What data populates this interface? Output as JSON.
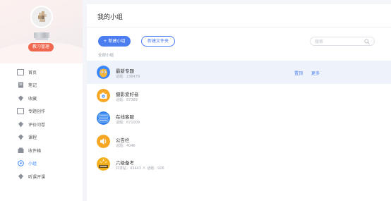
{
  "sidebar": {
    "manage_label": "教习管理",
    "items": [
      {
        "label": "首页",
        "icon": "home-icon"
      },
      {
        "label": "笔记",
        "icon": "note-icon"
      },
      {
        "label": "收藏",
        "icon": "bookmark-icon"
      },
      {
        "label": "专题创作",
        "icon": "topic-icon"
      },
      {
        "label": "评价问卷",
        "icon": "survey-icon"
      },
      {
        "label": "课程",
        "icon": "course-icon"
      },
      {
        "label": "收件箱",
        "icon": "inbox-icon"
      },
      {
        "label": "小组",
        "icon": "group-icon",
        "active": true
      },
      {
        "label": "听课评课",
        "icon": "lecture-icon"
      }
    ]
  },
  "main": {
    "title": "我的小组",
    "new_group_label": "+ 新建小组",
    "new_folder_label": "新建文件夹",
    "search_placeholder": "搜索",
    "section_label": "全部小组",
    "groups": [
      {
        "name": "最新专题",
        "meta": "话题：23647​9",
        "icon": "owl-icon",
        "color": "#3a86ff",
        "actions": [
          "置顶",
          "更多"
        ]
      },
      {
        "name": "摄影爱好者",
        "meta": "话题：87389",
        "icon": "camera-icon",
        "color": "#f5a623"
      },
      {
        "name": "在线客服",
        "meta": "话题：671009",
        "icon": "service-icon",
        "color": "#2f80ed"
      },
      {
        "name": "公告栏",
        "meta": "话题：4046",
        "icon": "speaker-icon",
        "color": "#f5a623"
      },
      {
        "name": "六级备考",
        "meta": "共享帖：43443 人 话题：926",
        "icon": "cet6-icon",
        "color": "#f2b01e"
      }
    ]
  },
  "colors": {
    "accent": "#4a7df0",
    "manage_button": "#f0674f",
    "active_nav": "#3a86ff"
  }
}
